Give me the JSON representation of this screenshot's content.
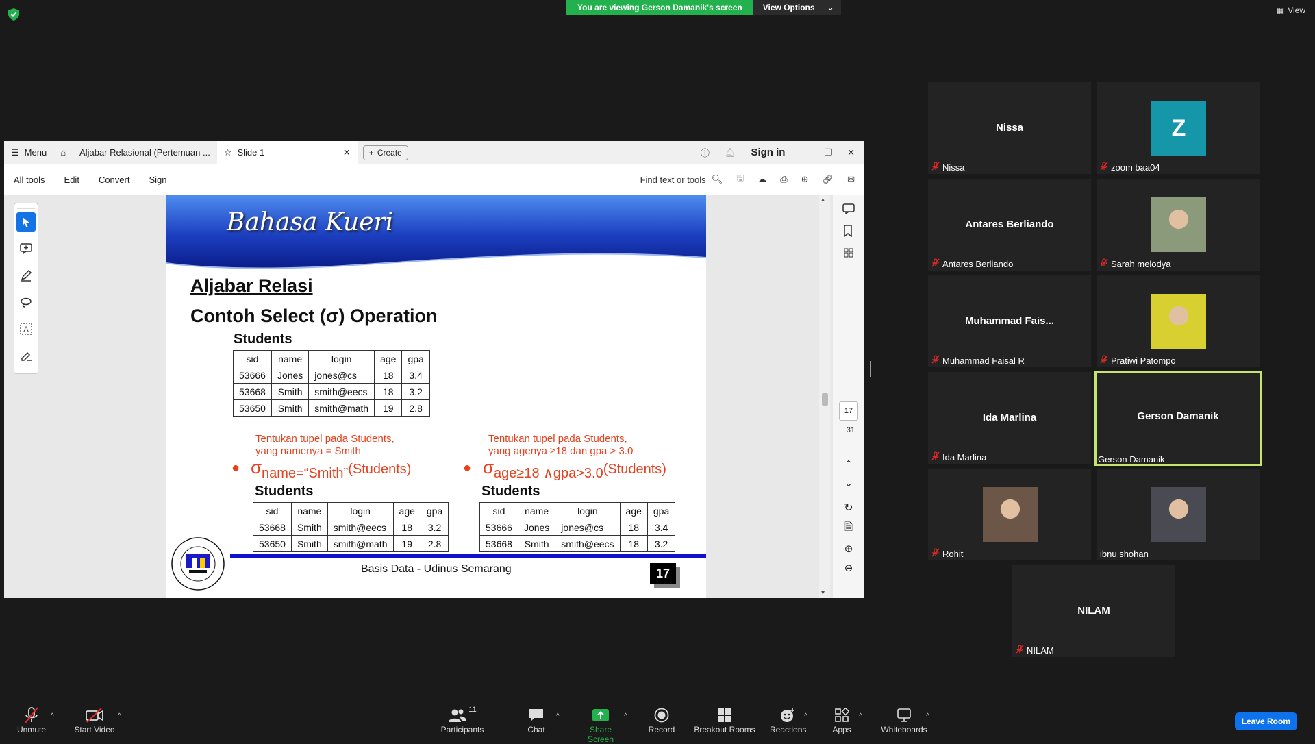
{
  "banner": {
    "viewing": "You are viewing Gerson Damanik's screen",
    "options": "View Options",
    "view": "View"
  },
  "acrobat": {
    "menu": "Menu",
    "tab_doc": "Aljabar Relasional (Pertemuan ...",
    "tab_slide": "Slide 1",
    "create": "Create",
    "signin": "Sign in",
    "toolbar": [
      "All tools",
      "Edit",
      "Convert",
      "Sign"
    ],
    "find": "Find text or tools",
    "page_current": "17",
    "page_total": "31"
  },
  "slide": {
    "header": "Bahasa Kueri",
    "h1": "Aljabar Relasi",
    "h2": "Contoh Select (σ) Operation",
    "table_label": "Students",
    "columns": [
      "sid",
      "name",
      "login",
      "age",
      "gpa"
    ],
    "main_rows": [
      [
        "53666",
        "Jones",
        "jones@cs",
        "18",
        "3.4"
      ],
      [
        "53668",
        "Smith",
        "smith@eecs",
        "18",
        "3.2"
      ],
      [
        "53650",
        "Smith",
        "smith@math",
        "19",
        "2.8"
      ]
    ],
    "note_left_1": "Tentukan tupel pada Students,",
    "note_left_2": "yang namenya = Smith",
    "note_right_1": "Tentukan tupel pada Students,",
    "note_right_2": "yang agenya ≥18 dan gpa > 3.0",
    "expr_left_sigma": "σ",
    "expr_left_sub": "name=“Smith”",
    "expr_left_rel": "(Students)",
    "expr_right_sigma": "σ",
    "expr_right_sub": "age≥18 ∧gpa>3.0",
    "expr_right_rel": "(Students)",
    "left_rows": [
      [
        "53668",
        "Smith",
        "smith@eecs",
        "18",
        "3.2"
      ],
      [
        "53650",
        "Smith",
        "smith@math",
        "19",
        "2.8"
      ]
    ],
    "right_rows": [
      [
        "53666",
        "Jones",
        "jones@cs",
        "18",
        "3.4"
      ],
      [
        "53668",
        "Smith",
        "smith@eecs",
        "18",
        "3.2"
      ]
    ],
    "footer": "Basis Data - Udinus Semarang",
    "page_number": "17"
  },
  "participants": [
    {
      "display": "Nissa",
      "label": "Nissa",
      "avatar": "none"
    },
    {
      "display": "Z",
      "label": "zoom baa04",
      "avatar": "letter"
    },
    {
      "display": "Antares Berliando",
      "label": "Antares Berliando",
      "avatar": "none"
    },
    {
      "display": "",
      "label": "Sarah melodya",
      "avatar": "photo"
    },
    {
      "display": "Muhammad  Fais...",
      "label": "Muhammad Faisal R",
      "avatar": "none"
    },
    {
      "display": "",
      "label": "Pratiwi Patompo",
      "avatar": "photo"
    },
    {
      "display": "Ida Marlina",
      "label": "Ida Marlina",
      "avatar": "none"
    },
    {
      "display": "Gerson Damanik",
      "label": "Gerson Damanik",
      "avatar": "none"
    },
    {
      "display": "",
      "label": "Rohit",
      "avatar": "photo"
    },
    {
      "display": "",
      "label": "ibnu shohan",
      "avatar": "photo"
    },
    {
      "display": "NILAM",
      "label": "NILAM",
      "avatar": "none"
    }
  ],
  "bottom": {
    "unmute": "Unmute",
    "start_video": "Start Video",
    "participants": "Participants",
    "participants_count": "11",
    "chat": "Chat",
    "share": "Share Screen",
    "record": "Record",
    "breakout": "Breakout Rooms",
    "reactions": "Reactions",
    "apps": "Apps",
    "whiteboards": "Whiteboards",
    "leave": "Leave Room"
  },
  "colors": {
    "share_green": "#23b14d",
    "speaker_outline": "#c5e36e",
    "leave_blue": "#0e72ed",
    "slide_red": "#e8401c",
    "avatar_teal": "#1597a9"
  }
}
